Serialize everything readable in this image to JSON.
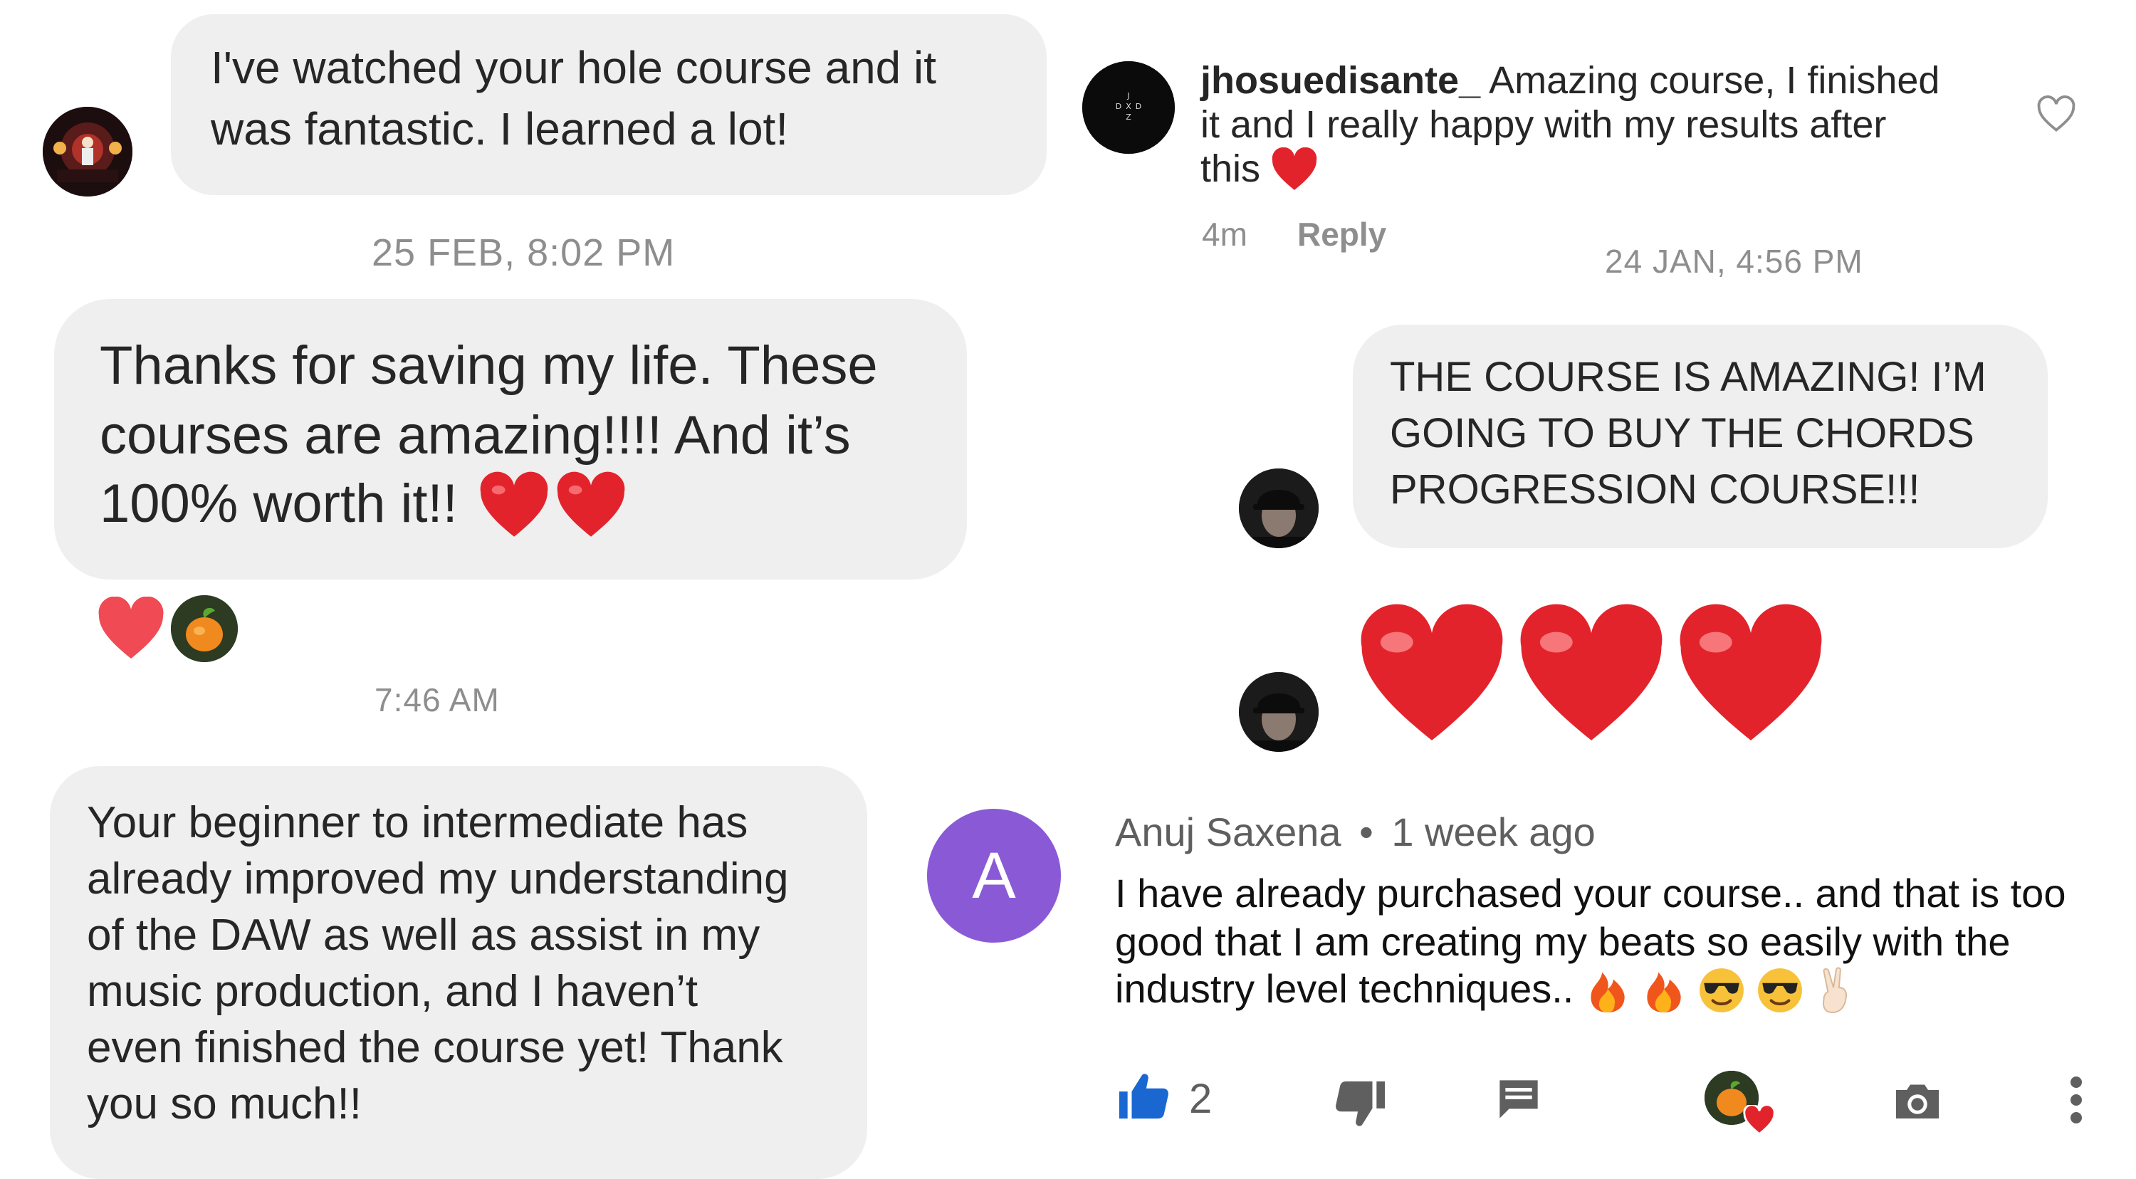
{
  "left": {
    "msg1": {
      "line1": "I've watched your hole course and it",
      "line2": "was fantastic. I learned a lot!"
    },
    "ts1": "25 FEB, 8:02 PM",
    "msg2": {
      "line1": "Thanks for saving my life. These",
      "line2": "courses are amazing!!!! And it’s",
      "line3": "100% worth it!!"
    },
    "ts2": "7:46 AM",
    "msg3": {
      "line1": "Your beginner to intermediate has",
      "line2": "already improved my understanding",
      "line3": "of the DAW as well as assist in my",
      "line4": "music production, and I haven’t",
      "line5": "even finished the course yet! Thank",
      "line6": "you so much!!"
    }
  },
  "right": {
    "comment1": {
      "username": "jhosuedisante_",
      "text1": "Amazing course,  I finished",
      "text2": "it and I really happy with my results after",
      "text3": "this",
      "time": "4m",
      "reply": "Reply",
      "avatar_letters": [
        "J",
        "D",
        "X",
        "D",
        "Z"
      ]
    },
    "ts3": "24 JAN, 4:56 PM",
    "msg4": {
      "line1": "THE COURSE IS AMAZING! I’M",
      "line2": "GOING TO BUY THE CHORDS",
      "line3": "PROGRESSION COURSE!!!"
    },
    "yt": {
      "avatar_letter": "A",
      "author": "Anuj Saxena",
      "separator": "•",
      "age": "1 week ago",
      "text1": "I have already purchased your course.. and that is too",
      "text2": "good that I am creating my beats so easily with the",
      "text3": "industry level techniques..",
      "likes": "2"
    }
  },
  "colors": {
    "bubble": "#efefef",
    "heart_red": "#e3232c",
    "timestamp": "#8e8e8e",
    "yt_avatar": "#8a5ad6",
    "like_blue": "#1a67d2",
    "icon_gray": "#5f5f5f"
  }
}
